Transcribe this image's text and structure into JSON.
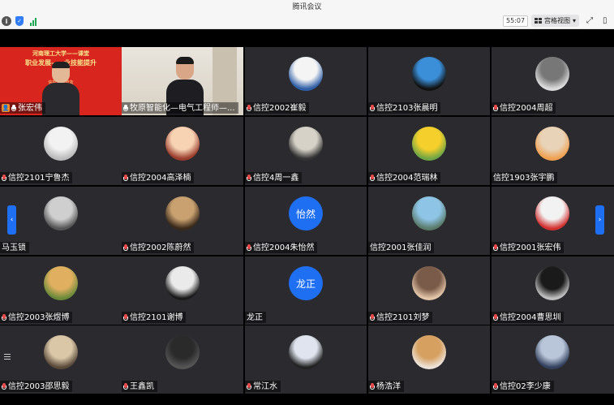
{
  "window": {
    "title": "腾讯会议"
  },
  "toolbar": {
    "timer": "55:07",
    "view_label": "宫格视图",
    "view_caret": "▾",
    "fullscreen_icon": "⤢",
    "sidebar_icon": "▯"
  },
  "colors": {
    "tile_bg": "#2b2b2f",
    "stage_bg": "#000000",
    "accent": "#1f6ff3",
    "muted_mic": "#e84a4a"
  },
  "presenter_banner": {
    "line1": "河南理工大学——课堂",
    "line2": "职业发展——业技能提升",
    "line3": "信控11级校友"
  },
  "tiles": [
    {
      "name": "张宏伟",
      "mic": "normal",
      "video": "red"
    },
    {
      "name": "牧原智能化—电气工程师—...",
      "mic": "normal",
      "video": "room"
    },
    {
      "name": "信控2002崔毅",
      "mic": "muted",
      "avatar": "img",
      "c1": "#f4f4f4",
      "c2": "#2f5fa8"
    },
    {
      "name": "信控2103张晨明",
      "mic": "muted",
      "avatar": "img",
      "c1": "#3b8fd8",
      "c2": "#111"
    },
    {
      "name": "信控2004周超",
      "mic": "muted",
      "avatar": "img",
      "c1": "#777",
      "c2": "#dcdcdc"
    },
    {
      "name": "信控2101宁鲁杰",
      "mic": "muted",
      "avatar": "img",
      "c1": "#f2f2f2",
      "c2": "#bbb"
    },
    {
      "name": "信控2004高泽楠",
      "mic": "muted",
      "avatar": "img",
      "c1": "#f7d2b3",
      "c2": "#9a3d2c"
    },
    {
      "name": "信控4周一鑫",
      "mic": "muted",
      "avatar": "img",
      "c1": "#d6d2c8",
      "c2": "#333"
    },
    {
      "name": "信控2004范瑞林",
      "mic": "muted",
      "avatar": "img",
      "c1": "#f5cf2b",
      "c2": "#6fa545"
    },
    {
      "name": "信控1903张宇鹏",
      "mic": "none",
      "avatar": "img",
      "c1": "#e8d3b8",
      "c2": "#f0a050"
    },
    {
      "name": "马玉锁",
      "mic": "none",
      "avatar": "img",
      "c1": "#cfcfcf",
      "c2": "#555"
    },
    {
      "name": "信控2002陈蔚然",
      "mic": "muted",
      "avatar": "img",
      "c1": "#c9a170",
      "c2": "#3a2a1a"
    },
    {
      "name": "信控2004朱怡然",
      "mic": "muted",
      "avatar": "text",
      "avatar_text": "怡然"
    },
    {
      "name": "信控2001张佳润",
      "mic": "none",
      "avatar": "img",
      "c1": "#8ec4e6",
      "c2": "#5a7b6a"
    },
    {
      "name": "信控2001张宏伟",
      "mic": "muted",
      "avatar": "img",
      "c1": "#f2f2f2",
      "c2": "#d23030"
    },
    {
      "name": "信控2003张煜博",
      "mic": "muted",
      "avatar": "img",
      "c1": "#e0b060",
      "c2": "#6a8a3a"
    },
    {
      "name": "信控2101谢博",
      "mic": "muted",
      "avatar": "img",
      "c1": "#eaeaea",
      "c2": "#1a1a1a"
    },
    {
      "name": "龙正",
      "mic": "none",
      "avatar": "text",
      "avatar_text": "龙正"
    },
    {
      "name": "信控2101刘梦",
      "mic": "muted",
      "avatar": "img",
      "c1": "#7a5a48",
      "c2": "#e3c5a8"
    },
    {
      "name": "信控2004曹思圳",
      "mic": "muted",
      "avatar": "img",
      "c1": "#1a1a1a",
      "c2": "#bfbfbf"
    },
    {
      "name": "信控2003邵思毅",
      "mic": "muted",
      "avatar": "img",
      "c1": "#d9c7a8",
      "c2": "#5a4a3a"
    },
    {
      "name": "王鑫凯",
      "mic": "muted",
      "avatar": "img",
      "c1": "#2a2a2a",
      "c2": "#555"
    },
    {
      "name": "常江水",
      "mic": "muted",
      "avatar": "img",
      "c1": "#dfe4ee",
      "c2": "#222"
    },
    {
      "name": "杨浩洋",
      "mic": "muted",
      "avatar": "img",
      "c1": "#d6a060",
      "c2": "#ece2d8"
    },
    {
      "name": "信控02李少康",
      "mic": "muted",
      "avatar": "img",
      "c1": "#b9c6d9",
      "c2": "#33415e"
    }
  ],
  "nav": {
    "prev": "‹",
    "next": "›"
  }
}
